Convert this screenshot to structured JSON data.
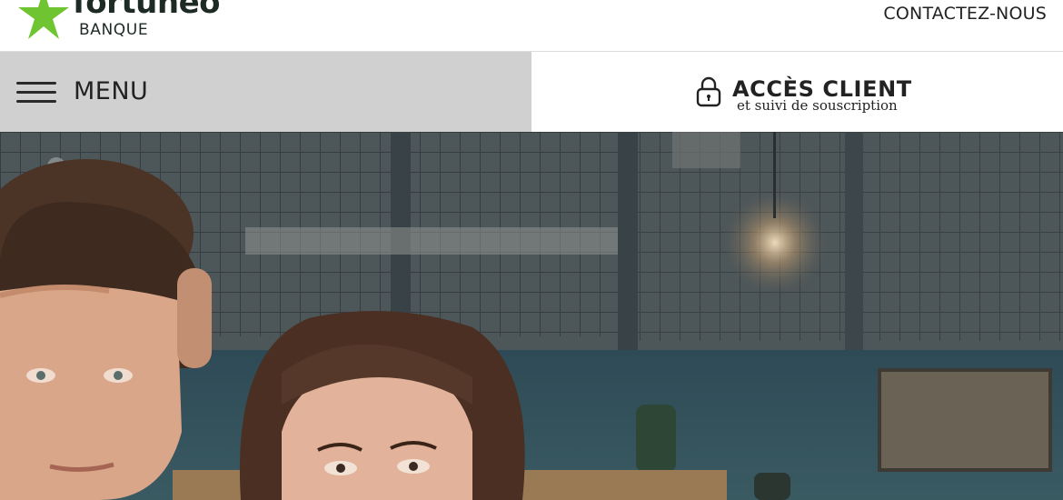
{
  "header": {
    "logo_word": "fortuneo",
    "logo_sub": "BANQUE",
    "contact_label": "CONTACTEZ-NOUS"
  },
  "nav": {
    "menu_label": "MENU",
    "client_title": "ACCÈS CLIENT",
    "client_sub": "et suivi de souscription"
  },
  "icons": {
    "menu": "hamburger-icon",
    "client": "lock-icon",
    "logo": "star-logo"
  },
  "colors": {
    "brand_green": "#6ec531",
    "menu_bg": "#d0d0d0",
    "text_dark": "#222222"
  }
}
